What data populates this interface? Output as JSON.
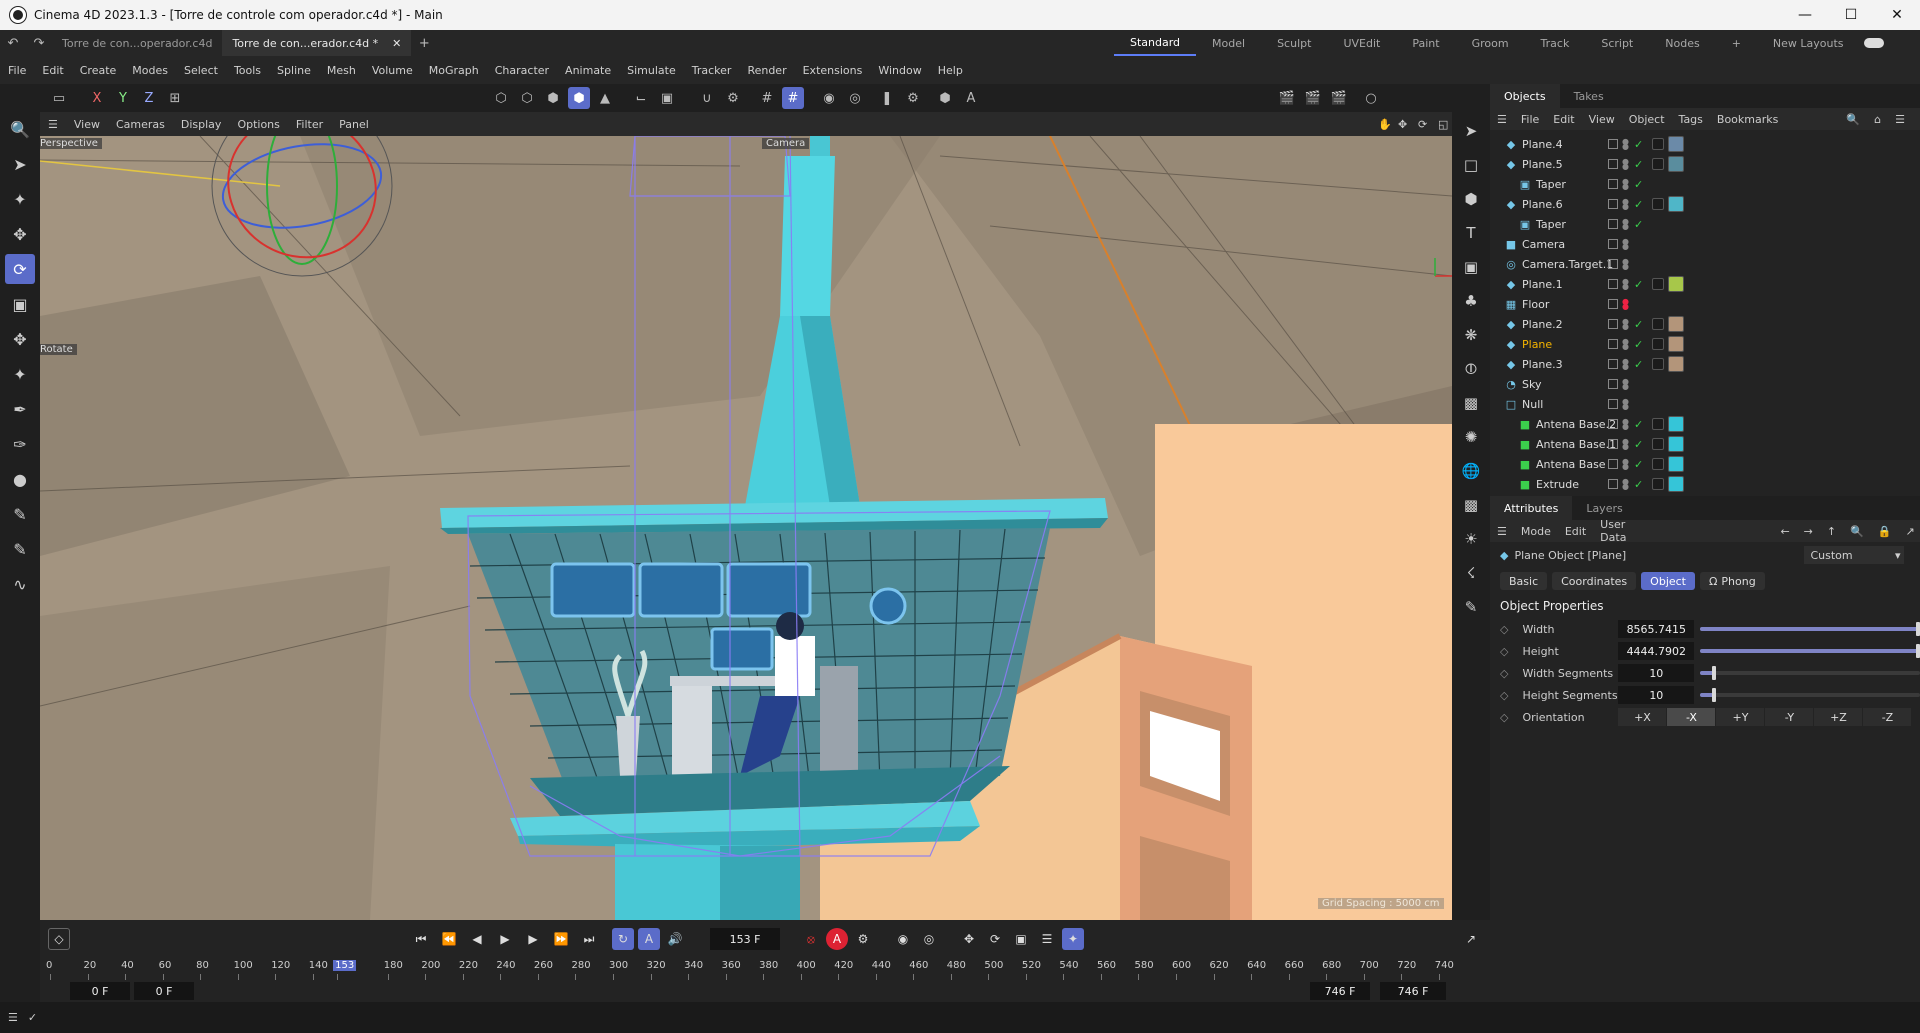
{
  "window": {
    "title": "Cinema 4D 2023.1.3 - [Torre de controle com operador.c4d *] - Main"
  },
  "doc_tabs": [
    "Torre de con...operador.c4d",
    "Torre de con...erador.c4d *"
  ],
  "layouts": [
    "Standard",
    "Model",
    "Sculpt",
    "UVEdit",
    "Paint",
    "Groom",
    "Track",
    "Script",
    "Nodes"
  ],
  "new_layouts": "New Layouts",
  "menu": [
    "File",
    "Edit",
    "Create",
    "Modes",
    "Select",
    "Tools",
    "Spline",
    "Mesh",
    "Volume",
    "MoGraph",
    "Character",
    "Animate",
    "Simulate",
    "Tracker",
    "Render",
    "Extensions",
    "Window",
    "Help"
  ],
  "axis_labels": [
    "X",
    "Y",
    "Z"
  ],
  "viewport": {
    "menu": [
      "View",
      "Cameras",
      "Display",
      "Options",
      "Filter",
      "Panel"
    ],
    "projection": "Perspective",
    "camera_label": "Camera",
    "tool_label": "Rotate",
    "grid_spacing": "Grid Spacing : 5000 cm"
  },
  "objects_panel": {
    "tabs": [
      "Objects",
      "Takes"
    ],
    "menu": [
      "File",
      "Edit",
      "View",
      "Object",
      "Tags",
      "Bookmarks"
    ],
    "rows": [
      {
        "name": "Plane.4",
        "indent": 0,
        "icon": "plane-icon",
        "check": true,
        "tags": [
          "#6b8aa8"
        ],
        "selected": false
      },
      {
        "name": "Plane.5",
        "indent": 0,
        "icon": "plane-icon",
        "check": true,
        "tags": [
          "#5a8d9e"
        ],
        "selected": false
      },
      {
        "name": "Taper",
        "indent": 1,
        "icon": "taper-icon",
        "check": true,
        "tags": [],
        "selected": false
      },
      {
        "name": "Plane.6",
        "indent": 0,
        "icon": "plane-icon",
        "check": true,
        "tags": [
          "#4fb6c8"
        ],
        "selected": false
      },
      {
        "name": "Taper",
        "indent": 1,
        "icon": "taper-icon",
        "check": true,
        "tags": [],
        "selected": false
      },
      {
        "name": "Camera",
        "indent": 0,
        "icon": "camera-icon",
        "check": false,
        "tags": [],
        "selected": false
      },
      {
        "name": "Camera.Target.1",
        "indent": 0,
        "icon": "target-icon",
        "check": false,
        "tags": [],
        "selected": false
      },
      {
        "name": "Plane.1",
        "indent": 0,
        "icon": "plane-icon",
        "check": true,
        "tags": [
          "#a7c74a"
        ],
        "selected": false
      },
      {
        "name": "Floor",
        "indent": 0,
        "icon": "floor-icon",
        "check": false,
        "tags": [],
        "selected": false
      },
      {
        "name": "Plane.2",
        "indent": 0,
        "icon": "plane-icon",
        "check": true,
        "tags": [
          "#b3957a"
        ],
        "selected": false
      },
      {
        "name": "Plane",
        "indent": 0,
        "icon": "plane-icon",
        "check": true,
        "tags": [
          "#b3957a"
        ],
        "selected": true
      },
      {
        "name": "Plane.3",
        "indent": 0,
        "icon": "plane-icon",
        "check": true,
        "tags": [
          "#b3957a"
        ],
        "selected": false
      },
      {
        "name": "Sky",
        "indent": 0,
        "icon": "sky-icon",
        "check": false,
        "tags": [],
        "selected": false
      },
      {
        "name": "Null",
        "indent": 0,
        "icon": "null-icon",
        "check": false,
        "tags": [],
        "selected": false
      },
      {
        "name": "Antena Base.2",
        "indent": 1,
        "icon": "cube-icon",
        "check": true,
        "tags": [
          "#35c5d8"
        ],
        "selected": false
      },
      {
        "name": "Antena Base.1",
        "indent": 1,
        "icon": "cube-icon",
        "check": true,
        "tags": [
          "#35c5d8"
        ],
        "selected": false
      },
      {
        "name": "Antena Base",
        "indent": 1,
        "icon": "cube-icon",
        "check": true,
        "tags": [
          "#35c5d8"
        ],
        "selected": false
      },
      {
        "name": "Extrude",
        "indent": 1,
        "icon": "cube-icon",
        "check": true,
        "tags": [
          "#35c5d8"
        ],
        "selected": false
      }
    ]
  },
  "attributes_panel": {
    "tabs": [
      "Attributes",
      "Layers"
    ],
    "menu": [
      "Mode",
      "Edit",
      "User Data"
    ],
    "object_title": "Plane Object [Plane]",
    "preset": "Custom",
    "subtabs": [
      "Basic",
      "Coordinates",
      "Object",
      "Phong"
    ],
    "active_subtab": "Object",
    "section": "Object Properties",
    "fields": [
      {
        "label": "Width",
        "value": "8565.7415",
        "slider": 1.0
      },
      {
        "label": "Height",
        "value": "4444.7902",
        "slider": 1.0
      },
      {
        "label": "Width Segments",
        "value": "10",
        "slider": 0.07
      },
      {
        "label": "Height Segments",
        "value": "10",
        "slider": 0.07
      }
    ],
    "orientation_label": "Orientation",
    "orientation_options": [
      "+X",
      "-X",
      "+Y",
      "-Y",
      "+Z",
      "-Z"
    ],
    "orientation_active": "-X"
  },
  "timeline": {
    "current_frame": "153 F",
    "start": "0 F",
    "start2": "0 F",
    "end": "746 F",
    "end2": "746 F",
    "ticks": [
      "0",
      "20",
      "40",
      "60",
      "80",
      "100",
      "120",
      "140",
      "153",
      "180",
      "200",
      "220",
      "240",
      "260",
      "280",
      "300",
      "320",
      "340",
      "360",
      "380",
      "400",
      "420",
      "440",
      "460",
      "480",
      "500",
      "520",
      "540",
      "560",
      "580",
      "600",
      "620",
      "640",
      "660",
      "680",
      "700",
      "720",
      "740"
    ]
  },
  "colors": {
    "accent": "#5b6cc9",
    "selected_text": "#f4b400",
    "tower": "#4fd1de",
    "wall": "#f6c99a",
    "ground": "#9f927f"
  }
}
